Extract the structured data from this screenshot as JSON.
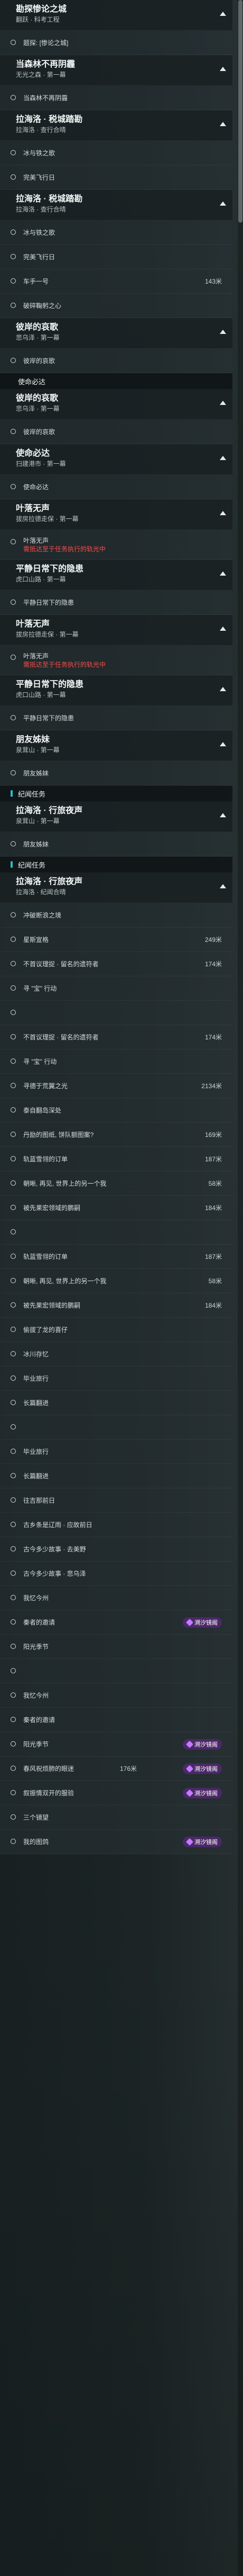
{
  "blocks": [
    {
      "kind": "group",
      "title": "勘探惨论之城",
      "sub": "翻跃 · 科考工程"
    },
    {
      "kind": "item",
      "label": "题探: [惨论之城]"
    },
    {
      "kind": "group",
      "title": "当森林不再阴霾",
      "sub": "无光之森 · 第一幕"
    },
    {
      "kind": "item",
      "label": "当森林不再阴霾"
    },
    {
      "kind": "group",
      "title": "拉海洛 · 税城踏勘",
      "sub": "拉海洛 · 查行合晴"
    },
    {
      "kind": "item",
      "label": "冰与铁之歌"
    },
    {
      "kind": "item",
      "label": "完美飞行日"
    },
    {
      "kind": "group",
      "title": "拉海洛 · 税城踏勘",
      "sub": "拉海洛 · 查行合晴"
    },
    {
      "kind": "item",
      "label": "冰与铁之歌"
    },
    {
      "kind": "item",
      "label": "完美飞行日"
    },
    {
      "kind": "item",
      "label": "车手一号",
      "dist": "143米"
    },
    {
      "kind": "item",
      "label": "破碎鞠躬之心"
    },
    {
      "kind": "group",
      "title": "彼岸的哀歌",
      "sub": "悲乌泽 · 第一幕"
    },
    {
      "kind": "item",
      "label": "彼岸的哀歌"
    },
    {
      "kind": "section",
      "label": "使命必达"
    },
    {
      "kind": "group",
      "title": "彼岸的哀歌",
      "sub": "悲乌泽 · 第一幕"
    },
    {
      "kind": "item",
      "label": "彼岸的哀歌"
    },
    {
      "kind": "group",
      "title": "使命必达",
      "sub": "扫建港市 · 第一幕"
    },
    {
      "kind": "item",
      "label": "使命必达"
    },
    {
      "kind": "group",
      "title": "叶落无声",
      "sub": "拔房拉德走保 · 第一幕"
    },
    {
      "kind": "item2",
      "label": "叶落无声",
      "warn": "需抵达至于任务执行的轨光中"
    },
    {
      "kind": "group",
      "title": "平静日常下的隐患",
      "sub": "虎口山路 · 第一幕"
    },
    {
      "kind": "item",
      "label": "平静日常下的隐患"
    },
    {
      "kind": "group",
      "title": "叶落无声",
      "sub": "拔房拉德走保 · 第一幕"
    },
    {
      "kind": "item2",
      "label": "叶落无声",
      "warn": "需抵达至于任务执行的轨光中"
    },
    {
      "kind": "group",
      "title": "平静日常下的隐患",
      "sub": "虎口山路 · 第一幕"
    },
    {
      "kind": "item",
      "label": "平静日常下的隐患"
    },
    {
      "kind": "group",
      "title": "朋友姊妹",
      "sub": "泉茸山 · 第一幕"
    },
    {
      "kind": "item",
      "label": "朋友姊妹"
    },
    {
      "kind": "section",
      "label": "纪闻任务",
      "accent": true
    },
    {
      "kind": "group",
      "title": "拉海洛 · 行旅夜声",
      "sub": "泉茸山 · 第一幕"
    },
    {
      "kind": "item",
      "label": "朋友姊妹"
    },
    {
      "kind": "section",
      "label": "纪闻任务",
      "accent": true
    },
    {
      "kind": "group",
      "title": "拉海洛 · 行旅夜声",
      "sub": "拉海洛 · 纪闻合晴"
    },
    {
      "kind": "item",
      "label": "冲破断浪之境"
    },
    {
      "kind": "item",
      "label": "星斯宣格",
      "dist": "249米"
    },
    {
      "kind": "item",
      "label": "不首议理捉 · 留名的遗符者",
      "dist": "174米"
    },
    {
      "kind": "item",
      "label": "寻 \"宝\" 行动"
    },
    {
      "kind": "item",
      "label": ""
    },
    {
      "kind": "item",
      "label": "不首议理捉 · 留名的遗符者",
      "dist": "174米"
    },
    {
      "kind": "item",
      "label": "寻 \"宝\" 行动"
    },
    {
      "kind": "item",
      "label": "寻德于荒翼之光",
      "dist": "2134米"
    },
    {
      "kind": "item",
      "label": "泰自翻岛深处"
    },
    {
      "kind": "item",
      "label": "丹励的图纸, 饼队额图案?",
      "dist": "169米"
    },
    {
      "kind": "item",
      "label": "轨蓝雪翎的订单",
      "dist": "187米"
    },
    {
      "kind": "item",
      "label": "朝晰, 再见, 世界上的另一个我",
      "dist": "58米"
    },
    {
      "kind": "item",
      "label": "被先果宏领域的鹏嗣",
      "dist": "184米"
    },
    {
      "kind": "item",
      "label": ""
    },
    {
      "kind": "item",
      "label": "轨蓝雪翎的订单",
      "dist": "187米"
    },
    {
      "kind": "item",
      "label": "朝晰, 再见, 世界上的另一个我",
      "dist": "58米"
    },
    {
      "kind": "item",
      "label": "被先果宏领域的鹏嗣",
      "dist": "184米"
    },
    {
      "kind": "item",
      "label": "偷拔了龙的喜仔"
    },
    {
      "kind": "item",
      "label": "冰川存忆"
    },
    {
      "kind": "item",
      "label": "毕业旅行"
    },
    {
      "kind": "item",
      "label": "长篇翻进"
    },
    {
      "kind": "item",
      "label": ""
    },
    {
      "kind": "item",
      "label": "毕业旅行"
    },
    {
      "kind": "item",
      "label": "长篇翻进"
    },
    {
      "kind": "item",
      "label": "往吉那前日"
    },
    {
      "kind": "item",
      "label": "古乡条是辽雨 · 应故前日"
    },
    {
      "kind": "item",
      "label": "古今多少故事 · 去美野"
    },
    {
      "kind": "item",
      "label": "古今多少故事 · 悲乌泽"
    },
    {
      "kind": "item",
      "label": "我忆今州"
    },
    {
      "kind": "item",
      "label": "秦者的邀请",
      "badge": "溯汐镜阁"
    },
    {
      "kind": "item",
      "label": "阳光季节"
    },
    {
      "kind": "item",
      "label": ""
    },
    {
      "kind": "item",
      "label": "我忆今州"
    },
    {
      "kind": "item",
      "label": "秦者的邀请"
    },
    {
      "kind": "item",
      "label": "阳光季节",
      "badge": "溯汐镜阁"
    },
    {
      "kind": "item",
      "label": "春风祝烦肺的眼迷",
      "dist": "176米",
      "badge": "溯汐镜阁"
    },
    {
      "kind": "item",
      "label": "叙振情双开的服验",
      "badge": "溯汐镜阁"
    },
    {
      "kind": "item",
      "label": "三个镜望"
    },
    {
      "kind": "item",
      "label": "我的图鸽",
      "badge": "溯汐镜阁"
    }
  ]
}
